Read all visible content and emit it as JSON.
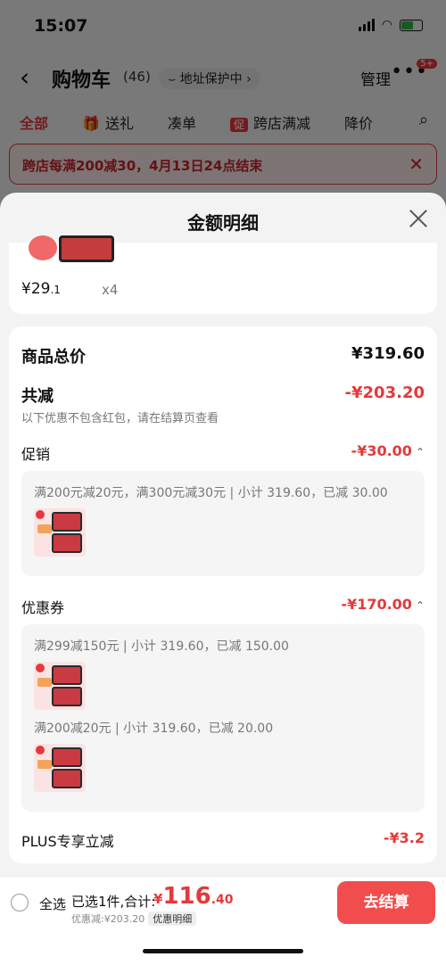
{
  "status": {
    "time": "15:07"
  },
  "header": {
    "back_icon": "‹",
    "title": "购物车",
    "count": "(46)",
    "address_protect": "⌣ 地址保护中 ›",
    "manage": "管理",
    "more_icon": "•••",
    "badge": "5+"
  },
  "filters": {
    "all": "全部",
    "gift_icon": "🎁",
    "gift": "送礼",
    "combine": "凑单",
    "promo_badge": "促",
    "cross_store": "跨店满减",
    "price_drop": "降价",
    "search_icon": "⌕"
  },
  "banner": {
    "text": "跨店每满200减30，4月13日24点结束",
    "close": "✕"
  },
  "sheet": {
    "title": "金额明细",
    "top_item": {
      "price_main": "¥29",
      "price_dec": ".1",
      "qty": "x4"
    },
    "total_label": "商品总价",
    "total_value": "¥319.60",
    "reduce_label": "共减",
    "reduce_value": "-¥203.20",
    "reduce_note": "以下优惠不包含红包，请在结算页查看",
    "promo": {
      "label": "促销",
      "value": "-¥30.00",
      "detail": "满200元减20元，满300元减30元 | 小计 319.60，已减 30.00"
    },
    "coupon": {
      "label": "优惠券",
      "value": "-¥170.00",
      "detail1": "满299减150元 | 小计 319.60，已减 150.00",
      "detail2": "满200减20元 | 小计 319.60，已减 20.00"
    },
    "plus": {
      "label": "PLUS专享立减",
      "value": "-¥3.2"
    },
    "chevron_up": "⌃"
  },
  "checkout": {
    "select_all": "全选",
    "selected": "已选1件,合计:",
    "currency": "¥",
    "amount_int": "116",
    "amount_dec": ".40",
    "saved": "优惠减:¥203.20",
    "detail_link": "优惠明细",
    "button": "去结算"
  },
  "colors": {
    "accent": "#e4393c",
    "button": "#f24d4d"
  }
}
